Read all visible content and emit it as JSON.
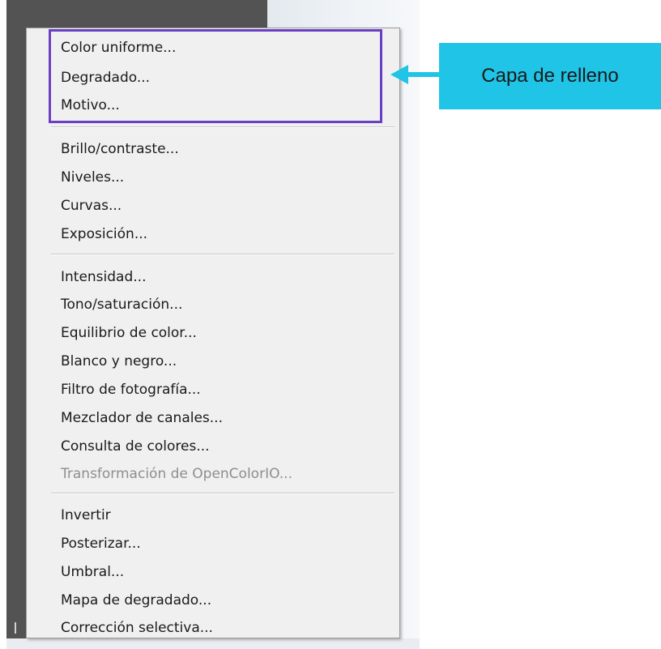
{
  "menu": {
    "groups": [
      {
        "items": [
          {
            "label": "Color uniforme...",
            "enabled": true
          },
          {
            "label": "Degradado...",
            "enabled": true
          },
          {
            "label": "Motivo...",
            "enabled": true
          }
        ]
      },
      {
        "items": [
          {
            "label": "Brillo/contraste...",
            "enabled": true
          },
          {
            "label": "Niveles...",
            "enabled": true
          },
          {
            "label": "Curvas...",
            "enabled": true
          },
          {
            "label": "Exposición...",
            "enabled": true
          }
        ]
      },
      {
        "items": [
          {
            "label": "Intensidad...",
            "enabled": true
          },
          {
            "label": "Tono/saturación...",
            "enabled": true
          },
          {
            "label": "Equilibrio de color...",
            "enabled": true
          },
          {
            "label": "Blanco y negro...",
            "enabled": true
          },
          {
            "label": "Filtro de fotografía...",
            "enabled": true
          },
          {
            "label": "Mezclador de canales...",
            "enabled": true
          },
          {
            "label": "Consulta de colores...",
            "enabled": true
          },
          {
            "label": "Transformación de OpenColorIO...",
            "enabled": false
          }
        ]
      },
      {
        "items": [
          {
            "label": "Invertir",
            "enabled": true
          },
          {
            "label": "Posterizar...",
            "enabled": true
          },
          {
            "label": "Umbral...",
            "enabled": true
          },
          {
            "label": "Mapa de degradado...",
            "enabled": true
          },
          {
            "label": "Corrección selectiva...",
            "enabled": true
          }
        ]
      }
    ]
  },
  "annotation": {
    "callout_text": "Capa de relleno",
    "callout_color": "#1fc4e6",
    "highlight_color": "#6a3fc4"
  }
}
